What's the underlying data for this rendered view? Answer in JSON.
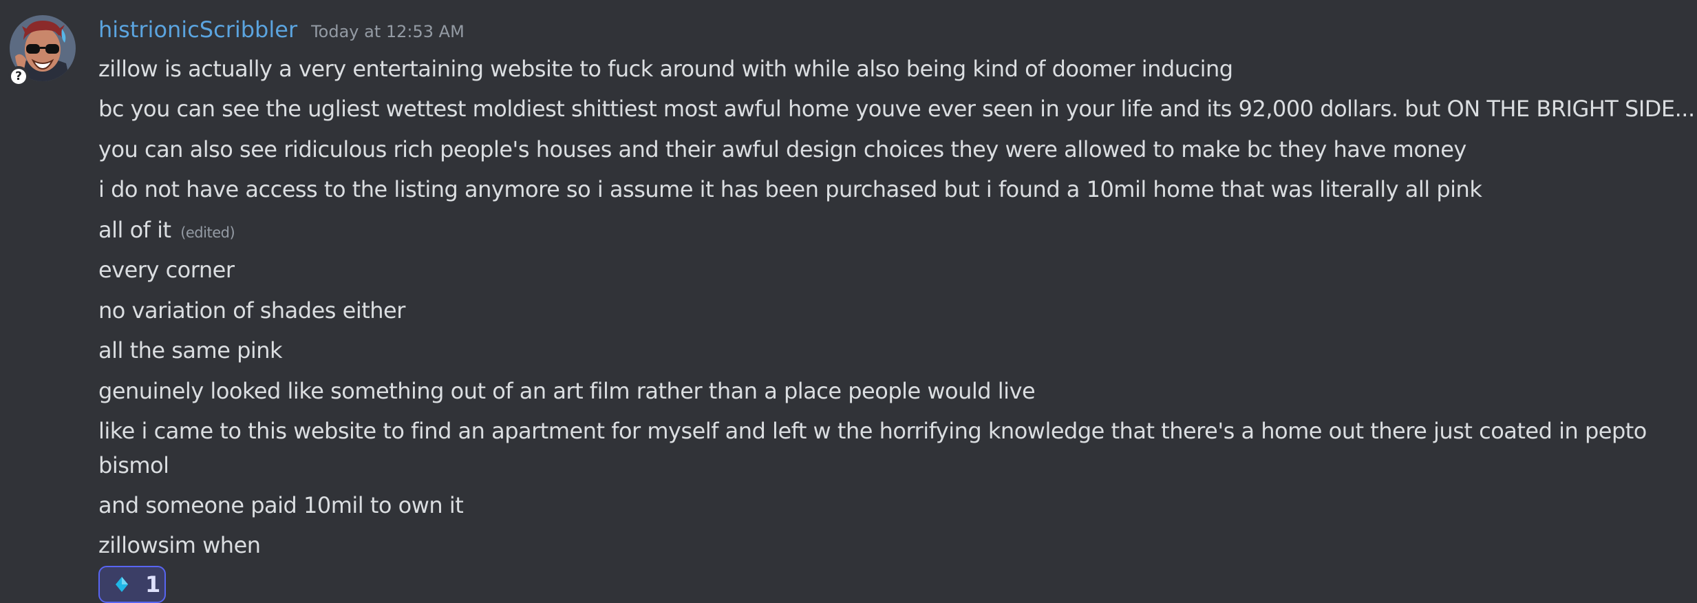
{
  "message": {
    "author": "histrionicScribbler",
    "timestamp": "Today at 12:53 AM",
    "avatar_badge": "?",
    "lines": [
      "zillow is actually a very entertaining website to fuck around with while also being kind of doomer inducing",
      "bc you can see the ugliest wettest moldiest shittiest most awful home youve ever seen in your life and its 92,000 dollars. but ON THE BRIGHT SIDE.....",
      "you can also see ridiculous rich people's houses and their awful design choices they were allowed to make bc they have money",
      "i do not have access to the listing anymore so i assume it has been purchased but i found a 10mil home that was literally all pink",
      "all of it",
      "every corner",
      "no variation of shades either",
      "all the same pink",
      "genuinely looked like something out of an art film rather than a place people would live",
      "like i came to this website to find an apartment for myself and left w the horrifying knowledge that there's a home out there just coated in pepto bismol",
      "and someone paid 10mil to own it",
      "zillowsim when"
    ],
    "edited_label": "(edited)"
  },
  "reaction": {
    "emoji": "diamond-emoji",
    "count": "1"
  },
  "colors": {
    "background": "#313338",
    "username": "#5ba4df",
    "text": "#dbdee1",
    "muted": "#949ba4",
    "reaction_border": "#5865f2",
    "reaction_bg": "#3b3e66",
    "diamond": "#1fb6e6"
  }
}
